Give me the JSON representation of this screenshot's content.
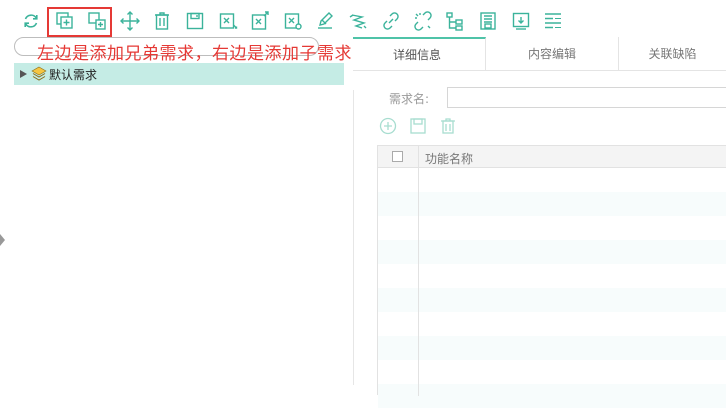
{
  "toolbar": {
    "buttons": [
      {
        "icon": "refresh-icon",
        "title": "refresh"
      },
      {
        "icon": "add-sibling-icon",
        "title": "add-sibling"
      },
      {
        "icon": "add-child-icon",
        "title": "add-child"
      },
      {
        "icon": "move-icon",
        "title": "move"
      },
      {
        "icon": "delete-icon",
        "title": "delete"
      },
      {
        "icon": "save-icon",
        "title": "save"
      },
      {
        "icon": "import-icon",
        "title": "import"
      },
      {
        "icon": "export-icon",
        "title": "export"
      },
      {
        "icon": "settings-doc-icon",
        "title": "settings"
      },
      {
        "icon": "edit-icon",
        "title": "edit"
      },
      {
        "icon": "layers-icon",
        "title": "layers"
      },
      {
        "icon": "link-icon",
        "title": "link"
      },
      {
        "icon": "unlink-icon",
        "title": "unlink"
      },
      {
        "icon": "tree-structure-icon",
        "title": "tree"
      },
      {
        "icon": "archive-icon",
        "title": "archive"
      },
      {
        "icon": "download-list-icon",
        "title": "download"
      },
      {
        "icon": "list-view-icon",
        "title": "list"
      }
    ],
    "accent": "#3bb39b"
  },
  "annotation": {
    "text": "左边是添加兄弟需求，右边是添加子需求",
    "color": "#e53935"
  },
  "tree": {
    "root_label": "默认需求",
    "selected_bg": "#c5ece5"
  },
  "tabs": [
    {
      "label": "详细信息",
      "active": true
    },
    {
      "label": "内容编辑",
      "active": false
    },
    {
      "label": "关联缺陷",
      "active": false
    }
  ],
  "form": {
    "req_name_label": "需求名:",
    "req_name_value": ""
  },
  "grid": {
    "columns": [
      "功能名称"
    ]
  }
}
